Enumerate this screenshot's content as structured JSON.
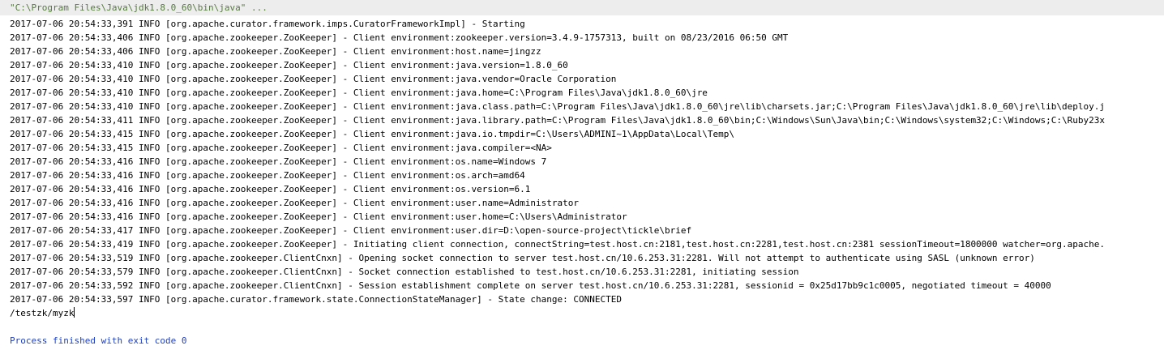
{
  "console": {
    "command": "\"C:\\Program Files\\Java\\jdk1.8.0_60\\bin\\java\" ...",
    "log_lines": [
      "2017-07-06 20:54:33,391 INFO [org.apache.curator.framework.imps.CuratorFrameworkImpl] - Starting",
      "2017-07-06 20:54:33,406 INFO [org.apache.zookeeper.ZooKeeper] - Client environment:zookeeper.version=3.4.9-1757313, built on 08/23/2016 06:50 GMT",
      "2017-07-06 20:54:33,406 INFO [org.apache.zookeeper.ZooKeeper] - Client environment:host.name=jingzz",
      "2017-07-06 20:54:33,410 INFO [org.apache.zookeeper.ZooKeeper] - Client environment:java.version=1.8.0_60",
      "2017-07-06 20:54:33,410 INFO [org.apache.zookeeper.ZooKeeper] - Client environment:java.vendor=Oracle Corporation",
      "2017-07-06 20:54:33,410 INFO [org.apache.zookeeper.ZooKeeper] - Client environment:java.home=C:\\Program Files\\Java\\jdk1.8.0_60\\jre",
      "2017-07-06 20:54:33,410 INFO [org.apache.zookeeper.ZooKeeper] - Client environment:java.class.path=C:\\Program Files\\Java\\jdk1.8.0_60\\jre\\lib\\charsets.jar;C:\\Program Files\\Java\\jdk1.8.0_60\\jre\\lib\\deploy.j",
      "2017-07-06 20:54:33,411 INFO [org.apache.zookeeper.ZooKeeper] - Client environment:java.library.path=C:\\Program Files\\Java\\jdk1.8.0_60\\bin;C:\\Windows\\Sun\\Java\\bin;C:\\Windows\\system32;C:\\Windows;C:\\Ruby23x",
      "2017-07-06 20:54:33,415 INFO [org.apache.zookeeper.ZooKeeper] - Client environment:java.io.tmpdir=C:\\Users\\ADMINI~1\\AppData\\Local\\Temp\\",
      "2017-07-06 20:54:33,415 INFO [org.apache.zookeeper.ZooKeeper] - Client environment:java.compiler=<NA>",
      "2017-07-06 20:54:33,416 INFO [org.apache.zookeeper.ZooKeeper] - Client environment:os.name=Windows 7",
      "2017-07-06 20:54:33,416 INFO [org.apache.zookeeper.ZooKeeper] - Client environment:os.arch=amd64",
      "2017-07-06 20:54:33,416 INFO [org.apache.zookeeper.ZooKeeper] - Client environment:os.version=6.1",
      "2017-07-06 20:54:33,416 INFO [org.apache.zookeeper.ZooKeeper] - Client environment:user.name=Administrator",
      "2017-07-06 20:54:33,416 INFO [org.apache.zookeeper.ZooKeeper] - Client environment:user.home=C:\\Users\\Administrator",
      "2017-07-06 20:54:33,417 INFO [org.apache.zookeeper.ZooKeeper] - Client environment:user.dir=D:\\open-source-project\\tickle\\brief",
      "2017-07-06 20:54:33,419 INFO [org.apache.zookeeper.ZooKeeper] - Initiating client connection, connectString=test.host.cn:2181,test.host.cn:2281,test.host.cn:2381 sessionTimeout=1800000 watcher=org.apache.",
      "2017-07-06 20:54:33,519 INFO [org.apache.zookeeper.ClientCnxn] - Opening socket connection to server test.host.cn/10.6.253.31:2281. Will not attempt to authenticate using SASL (unknown error)",
      "2017-07-06 20:54:33,579 INFO [org.apache.zookeeper.ClientCnxn] - Socket connection established to test.host.cn/10.6.253.31:2281, initiating session",
      "2017-07-06 20:54:33,592 INFO [org.apache.zookeeper.ClientCnxn] - Session establishment complete on server test.host.cn/10.6.253.31:2281, sessionid = 0x25d17bb9c1c0005, negotiated timeout = 40000",
      "2017-07-06 20:54:33,597 INFO [org.apache.curator.framework.state.ConnectionStateManager] - State change: CONNECTED"
    ],
    "output": "/testzk/myzk",
    "exit_message": "Process finished with exit code 0"
  },
  "colors": {
    "command": "#547a3c",
    "exit_message": "#1f3fbf",
    "log_text": "#000000",
    "background": "#ffffff"
  }
}
